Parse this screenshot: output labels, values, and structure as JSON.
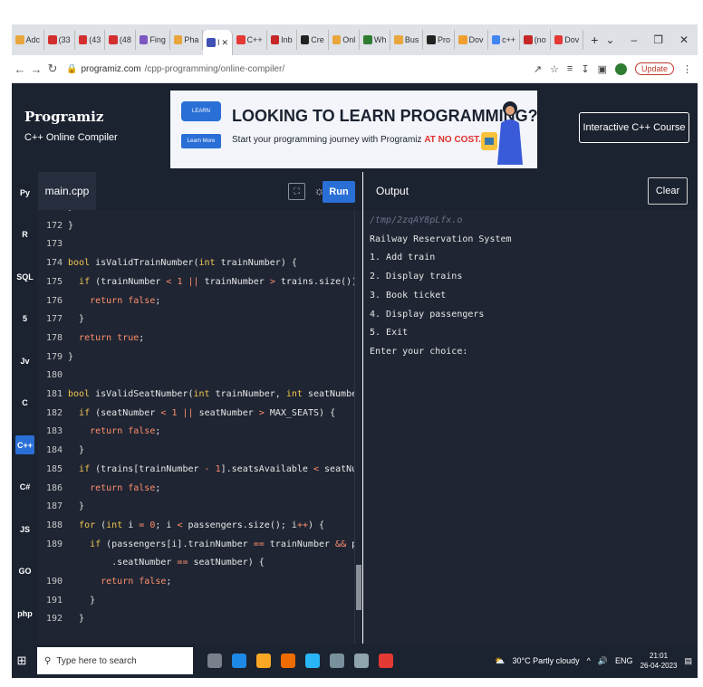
{
  "browser": {
    "tabs": [
      {
        "label": "Adc",
        "color": "#e8a63c"
      },
      {
        "label": "(33",
        "color": "#d32f2f"
      },
      {
        "label": "(43",
        "color": "#d32f2f"
      },
      {
        "label": "(48",
        "color": "#d32f2f"
      },
      {
        "label": "Fing",
        "color": "#7e57c2"
      },
      {
        "label": "Pha",
        "color": "#e8a63c"
      },
      {
        "label": "I",
        "color": "#3f51b5",
        "active": true
      },
      {
        "label": "C++",
        "color": "#e53935"
      },
      {
        "label": "Inb",
        "color": "#c62828"
      },
      {
        "label": "Cre",
        "color": "#222222"
      },
      {
        "label": "Onl",
        "color": "#e8a63c"
      },
      {
        "label": "Wh",
        "color": "#2e7d32"
      },
      {
        "label": "Bus",
        "color": "#e8a63c"
      },
      {
        "label": "Pro",
        "color": "#222222"
      },
      {
        "label": "Dov",
        "color": "#f0a030"
      },
      {
        "label": "c++",
        "color": "#4285f4"
      },
      {
        "label": "(no",
        "color": "#c62828"
      },
      {
        "label": "Dov",
        "color": "#e53935"
      }
    ],
    "new_tab": "+",
    "url_host": "programiz.com",
    "url_path": "/cpp-programming/online-compiler/",
    "update_label": "Update"
  },
  "site": {
    "logo": "Programiz",
    "subtitle": "C++ Online Compiler",
    "banner_logo": "LEARN PYTHON",
    "banner_button": "Learn More",
    "banner_title": "LOOKING TO LEARN PROGRAMMING?",
    "banner_text": "Start your programming journey with Programiz ",
    "banner_highlight": "AT NO COST.",
    "course_button": "Interactive C++ Course"
  },
  "sidebar": {
    "items": [
      {
        "label": "Py",
        "name": "python"
      },
      {
        "label": "R",
        "name": "r"
      },
      {
        "label": "SQL",
        "name": "sql"
      },
      {
        "label": "5",
        "name": "html"
      },
      {
        "label": "Jv",
        "name": "java"
      },
      {
        "label": "C",
        "name": "c"
      },
      {
        "label": "C++",
        "name": "cpp",
        "active": true
      },
      {
        "label": "C#",
        "name": "csharp"
      },
      {
        "label": "JS",
        "name": "javascript"
      },
      {
        "label": "GO",
        "name": "go"
      },
      {
        "label": "php",
        "name": "php"
      }
    ]
  },
  "editor": {
    "filename": "main.cpp",
    "run_label": "Run",
    "lines": [
      {
        "n": "171",
        "html": "}"
      },
      {
        "n": "172",
        "html": "}"
      },
      {
        "n": "173",
        "html": ""
      },
      {
        "n": "174",
        "html": "<span class=\"kw\">bool</span> isValidTrainNumber(<span class=\"kw\">int</span> trainNumber) {"
      },
      {
        "n": "175",
        "html": "  <span class=\"kw\">if</span> (trainNumber <span class=\"op\">&lt;</span> <span class=\"num\">1</span> <span class=\"op\">||</span> trainNumber <span class=\"op\">&gt;</span> trains.size()) {"
      },
      {
        "n": "176",
        "html": "    <span class=\"num\">return false</span>;"
      },
      {
        "n": "177",
        "html": "  }"
      },
      {
        "n": "178",
        "html": "  <span class=\"num\">return true</span>;"
      },
      {
        "n": "179",
        "html": "}"
      },
      {
        "n": "180",
        "html": ""
      },
      {
        "n": "181",
        "html": "<span class=\"kw\">bool</span> isValidSeatNumber(<span class=\"kw\">int</span> trainNumber, <span class=\"kw\">int</span> seatNumber) {"
      },
      {
        "n": "182",
        "html": "  <span class=\"kw\">if</span> (seatNumber <span class=\"op\">&lt;</span> <span class=\"num\">1</span> <span class=\"op\">||</span> seatNumber <span class=\"op\">&gt;</span> MAX_SEATS) {"
      },
      {
        "n": "183",
        "html": "    <span class=\"num\">return false</span>;"
      },
      {
        "n": "184",
        "html": "  }"
      },
      {
        "n": "185",
        "html": "  <span class=\"kw\">if</span> (trains[trainNumber <span class=\"op\">-</span> <span class=\"num\">1</span>].seatsAvailable <span class=\"op\">&lt;</span> seatNumber) {"
      },
      {
        "n": "186",
        "html": "    <span class=\"num\">return false</span>;"
      },
      {
        "n": "187",
        "html": "  }"
      },
      {
        "n": "188",
        "html": "  <span class=\"kw\">for</span> (<span class=\"kw\">int</span> i <span class=\"op\">=</span> <span class=\"num\">0</span>; i <span class=\"op\">&lt;</span> passengers.size(); i<span class=\"op\">++</span>) {"
      },
      {
        "n": "189",
        "html": "    <span class=\"kw\">if</span> (passengers[i].trainNumber <span class=\"op\">==</span> trainNumber <span class=\"op\">&amp;&amp;</span> passengers[i]"
      },
      {
        "n": "",
        "html": "        .seatNumber <span class=\"op\">==</span> seatNumber) {"
      },
      {
        "n": "190",
        "html": "      <span class=\"num\">return false</span>;"
      },
      {
        "n": "191",
        "html": "    }"
      },
      {
        "n": "192",
        "html": "  }"
      }
    ]
  },
  "output": {
    "title": "Output",
    "clear_label": "Clear",
    "lines": [
      "/tmp/2zqAY8pLfx.o",
      "Railway Reservation System",
      "1. Add train",
      "2. Display trains",
      "3. Book ticket",
      "4. Display passengers",
      "5. Exit",
      "Enter your choice: "
    ]
  },
  "taskbar": {
    "search_placeholder": "Type here to search",
    "weather": "30°C  Partly cloudy",
    "lang": "ENG",
    "time": "21:01",
    "date": "26-04-2023",
    "apps": [
      "#7a7f8c",
      "#1e88e5",
      "#f9a825",
      "#ef6c00",
      "#29b6f6",
      "#78909c",
      "#90a4ae",
      "#e53935"
    ]
  }
}
